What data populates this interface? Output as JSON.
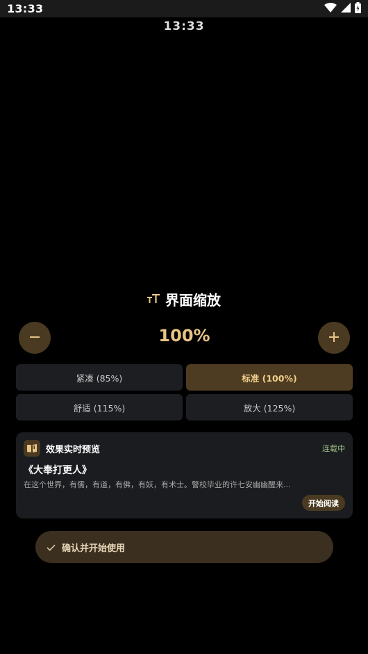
{
  "status_bar": {
    "time": "13:33",
    "icons": [
      "wifi-icon",
      "cell-signal-icon",
      "battery-charging-icon"
    ]
  },
  "clock": "13:33",
  "title": {
    "icon": "text-size-icon",
    "text": "界面缩放"
  },
  "scale": {
    "value": "100%",
    "minus_icon": "minus-icon",
    "plus_icon": "plus-icon"
  },
  "options": [
    {
      "label": "紧凑 (85%)",
      "active": false
    },
    {
      "label": "标准 (100%)",
      "active": true
    },
    {
      "label": "舒适 (115%)",
      "active": false
    },
    {
      "label": "放大 (125%)",
      "active": false
    }
  ],
  "preview": {
    "icon": "book-icon",
    "title": "效果实时预览",
    "status": "连载中",
    "book_title": "《大奉打更人》",
    "excerpt": "在这个世界，有儒，有道，有佛，有妖，有术士。警校毕业的许七安幽幽醒来...",
    "read_button": "开始阅读"
  },
  "confirm": {
    "icon": "check-icon",
    "label": "确认并开始使用"
  },
  "colors": {
    "accent": "#e8c484",
    "accent_dark": "#4a3a22",
    "card_bg": "#1b1c20",
    "status_green": "#9fbf86"
  }
}
